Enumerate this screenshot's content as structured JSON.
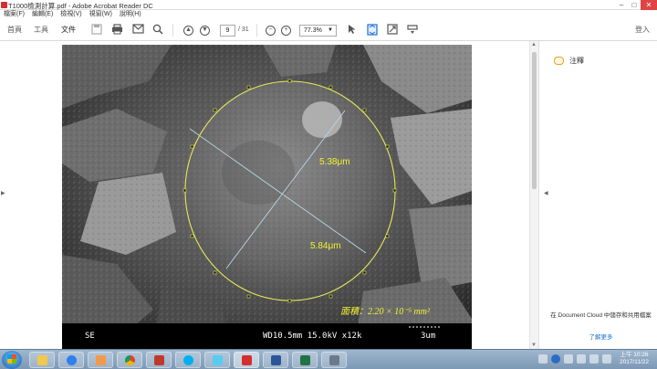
{
  "window": {
    "title": "T1000檢測計算.pdf - Adobe Acrobat Reader DC"
  },
  "menubar": {
    "items": [
      "檔案(F)",
      "編輯(E)",
      "檢視(V)",
      "視窗(W)",
      "說明(H)"
    ]
  },
  "toolbar": {
    "home_label": "首頁",
    "tools_label": "工具",
    "document_label": "文件",
    "current_page": "9",
    "total_pages": "/ 31",
    "zoom_value": "77.3%",
    "signin_label": "登入"
  },
  "image": {
    "measure_top": "5.38μm",
    "measure_bottom": "5.84μm",
    "area_label": "面積：2.20 × 10⁻⁵ mm²",
    "sem_left": "SE",
    "sem_info": "WD10.5mm 15.0kV x12k",
    "sem_scale": "3um"
  },
  "rightpane": {
    "comment_label": "注釋",
    "cloud_text": "在 Document Cloud 中儲存和共用檔案",
    "learn_more": "了解更多"
  },
  "taskbar": {
    "time": "上午 10:26",
    "date": "2017/11/22"
  },
  "colors": {
    "accent": "#1a6fd1",
    "measure_text": "#f2f230",
    "ellipse": "#e8e85a",
    "measure_line": "#b7d7e0",
    "close_button": "#e04343"
  }
}
